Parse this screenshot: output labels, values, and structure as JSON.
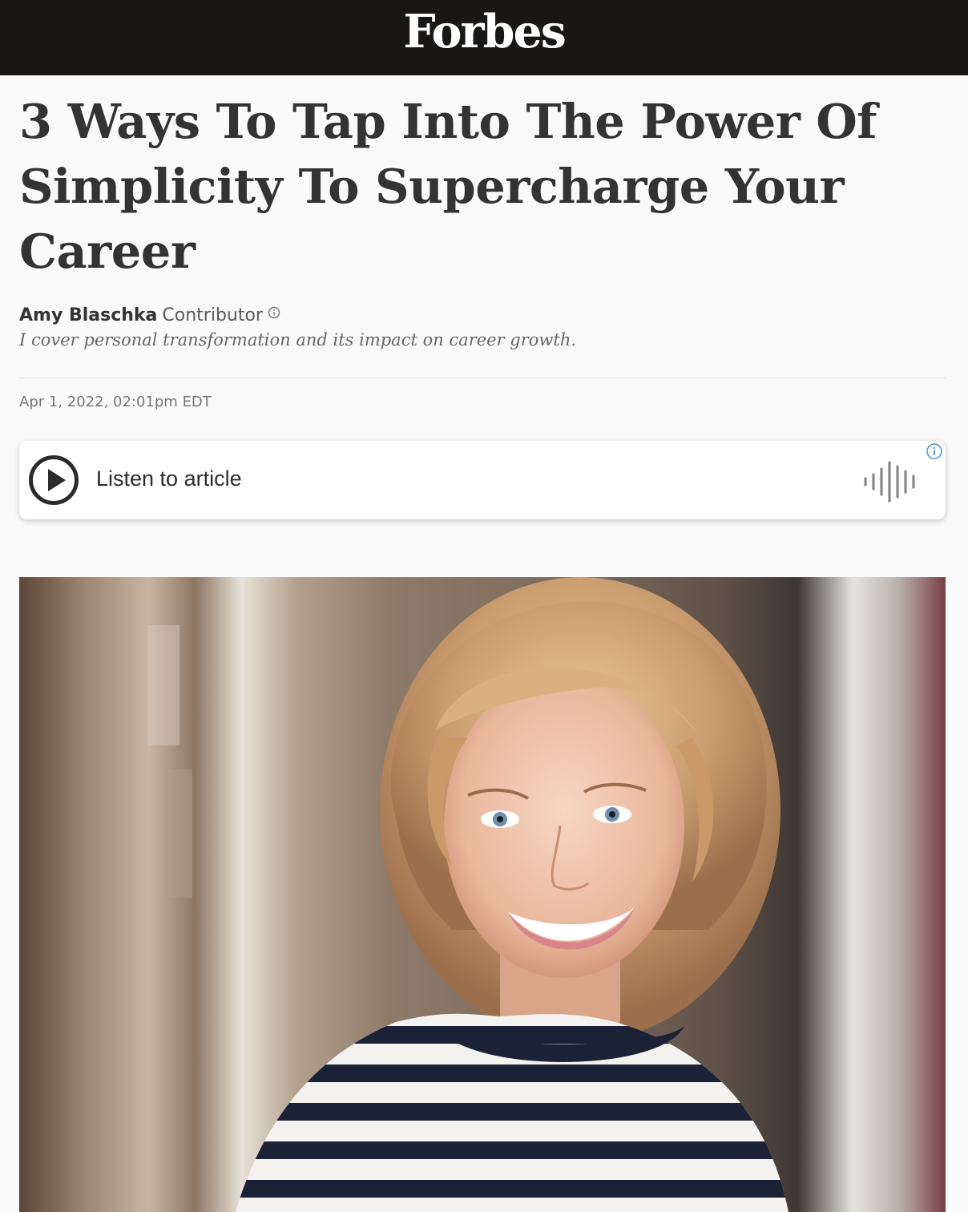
{
  "brand": {
    "logo_text": "Forbes",
    "bar_color": "#181716"
  },
  "article": {
    "headline": "3 Ways To Tap Into The Power Of Simplicity To Supercharge Your Career",
    "author": {
      "name": "Amy Blaschka",
      "role": "Contributor",
      "bio": "I cover personal transformation and its impact on career growth."
    },
    "date": "Apr 1, 2022, 02:01pm EDT"
  },
  "audio_player": {
    "label": "Listen to article",
    "play_icon": "play-circle-icon",
    "wave_icon": "audio-waveform-icon",
    "info_icon": "info-icon",
    "info_color": "#4a90d9"
  },
  "hero_image": {
    "alt": "Portrait of a smiling woman with blonde hair wearing a navy and white striped top"
  }
}
